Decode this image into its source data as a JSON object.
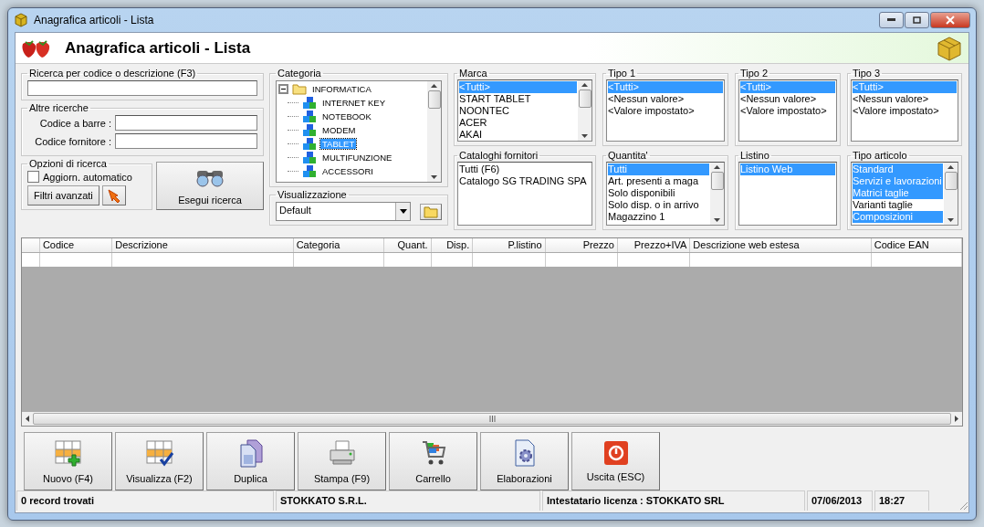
{
  "window": {
    "title": "Anagrafica articoli  - Lista"
  },
  "header": {
    "title": "Anagrafica articoli  - Lista"
  },
  "search": {
    "title": "Ricerca per codice o descrizione (F3)"
  },
  "other_searches": {
    "title": "Altre ricerche",
    "fields": [
      {
        "label": "Codice a barre :"
      },
      {
        "label": "Codice fornitore :"
      }
    ]
  },
  "search_options": {
    "title": "Opzioni di ricerca",
    "checkbox": {
      "label": "Aggiorn. automatico",
      "checked": false
    },
    "button": "Filtri avanzati"
  },
  "run_search": {
    "label": "Esegui ricerca"
  },
  "category": {
    "title": "Categoria",
    "tree": [
      {
        "label": "INFORMATICA",
        "expanded": true,
        "selected": false,
        "children": [
          {
            "label": "INTERNET KEY",
            "selected": false
          },
          {
            "label": "NOTEBOOK",
            "selected": false
          },
          {
            "label": "MODEM",
            "selected": false
          },
          {
            "label": "TABLET",
            "selected": true
          },
          {
            "label": "MULTIFUNZIONE",
            "selected": false
          },
          {
            "label": "ACCESSORI",
            "selected": false
          }
        ]
      }
    ]
  },
  "view": {
    "title": "Visualizzazione",
    "value": "Default"
  },
  "filters": [
    {
      "title": "Marca",
      "scrollbar": true,
      "items": [
        {
          "label": "<Tutti>",
          "selected": true
        },
        {
          "label": "START TABLET",
          "selected": false
        },
        {
          "label": "NOONTEC",
          "selected": false
        },
        {
          "label": "ACER",
          "selected": false
        },
        {
          "label": "AKAI",
          "selected": false
        }
      ]
    },
    {
      "title": "Tipo 1",
      "scrollbar": false,
      "items": [
        {
          "label": "<Tutti>",
          "selected": true
        },
        {
          "label": "<Nessun valore>",
          "selected": false
        },
        {
          "label": "<Valore impostato>",
          "selected": false
        }
      ]
    },
    {
      "title": "Tipo 2",
      "scrollbar": false,
      "items": [
        {
          "label": "<Tutti>",
          "selected": true
        },
        {
          "label": "<Nessun valore>",
          "selected": false
        },
        {
          "label": "<Valore impostato>",
          "selected": false
        }
      ]
    },
    {
      "title": "Tipo 3",
      "scrollbar": false,
      "items": [
        {
          "label": "<Tutti>",
          "selected": true
        },
        {
          "label": "<Nessun valore>",
          "selected": false
        },
        {
          "label": "<Valore impostato>",
          "selected": false
        }
      ]
    },
    {
      "title": "Cataloghi fornitori",
      "scrollbar": false,
      "items": [
        {
          "label": "Tutti (F6)",
          "selected": false
        },
        {
          "label": "Catalogo SG TRADING SPA",
          "selected": false
        }
      ]
    },
    {
      "title": "Quantita'",
      "scrollbar": true,
      "items": [
        {
          "label": "Tutti",
          "selected": true
        },
        {
          "label": "Art. presenti a maga",
          "selected": false
        },
        {
          "label": "Solo disponibili",
          "selected": false
        },
        {
          "label": "Solo disp. o in arrivo",
          "selected": false
        },
        {
          "label": "Magazzino 1",
          "selected": false
        }
      ]
    },
    {
      "title": "Listino",
      "scrollbar": false,
      "items": [
        {
          "label": "Listino Web",
          "selected": true
        }
      ]
    },
    {
      "title": "Tipo articolo",
      "scrollbar": true,
      "items": [
        {
          "label": "Standard",
          "selected": true
        },
        {
          "label": "Servizi e lavorazioni",
          "selected": true
        },
        {
          "label": "Matrici taglie",
          "selected": true
        },
        {
          "label": "Varianti taglie",
          "selected": false
        },
        {
          "label": "Composizioni",
          "selected": true
        }
      ]
    }
  ],
  "table": {
    "columns": [
      {
        "label": "Codice",
        "kind": "text"
      },
      {
        "label": "Descrizione",
        "kind": "text"
      },
      {
        "label": "Categoria",
        "kind": "text"
      },
      {
        "label": "Quant.",
        "kind": "number"
      },
      {
        "label": "Disp.",
        "kind": "number"
      },
      {
        "label": "P.listino",
        "kind": "number"
      },
      {
        "label": "Prezzo",
        "kind": "number"
      },
      {
        "label": "Prezzo+IVA",
        "kind": "number"
      },
      {
        "label": "Descrizione web estesa",
        "kind": "text"
      },
      {
        "label": "Codice EAN",
        "kind": "text"
      }
    ]
  },
  "actions": [
    {
      "kind": "new",
      "label": "Nuovo (F4)"
    },
    {
      "kind": "view",
      "label": "Visualizza (F2)"
    },
    {
      "kind": "duplicate",
      "label": "Duplica"
    },
    {
      "kind": "print",
      "label": "Stampa (F9)"
    },
    {
      "kind": "cart",
      "label": "Carrello"
    },
    {
      "kind": "process",
      "label": "Elaborazioni"
    },
    {
      "kind": "exit",
      "label": "Uscita (ESC)"
    }
  ],
  "status_bar": [
    "0 record trovati",
    "STOKKATO S.R.L.",
    "Intestatario licenza : STOKKATO SRL",
    "07/06/2013",
    "18:27"
  ]
}
